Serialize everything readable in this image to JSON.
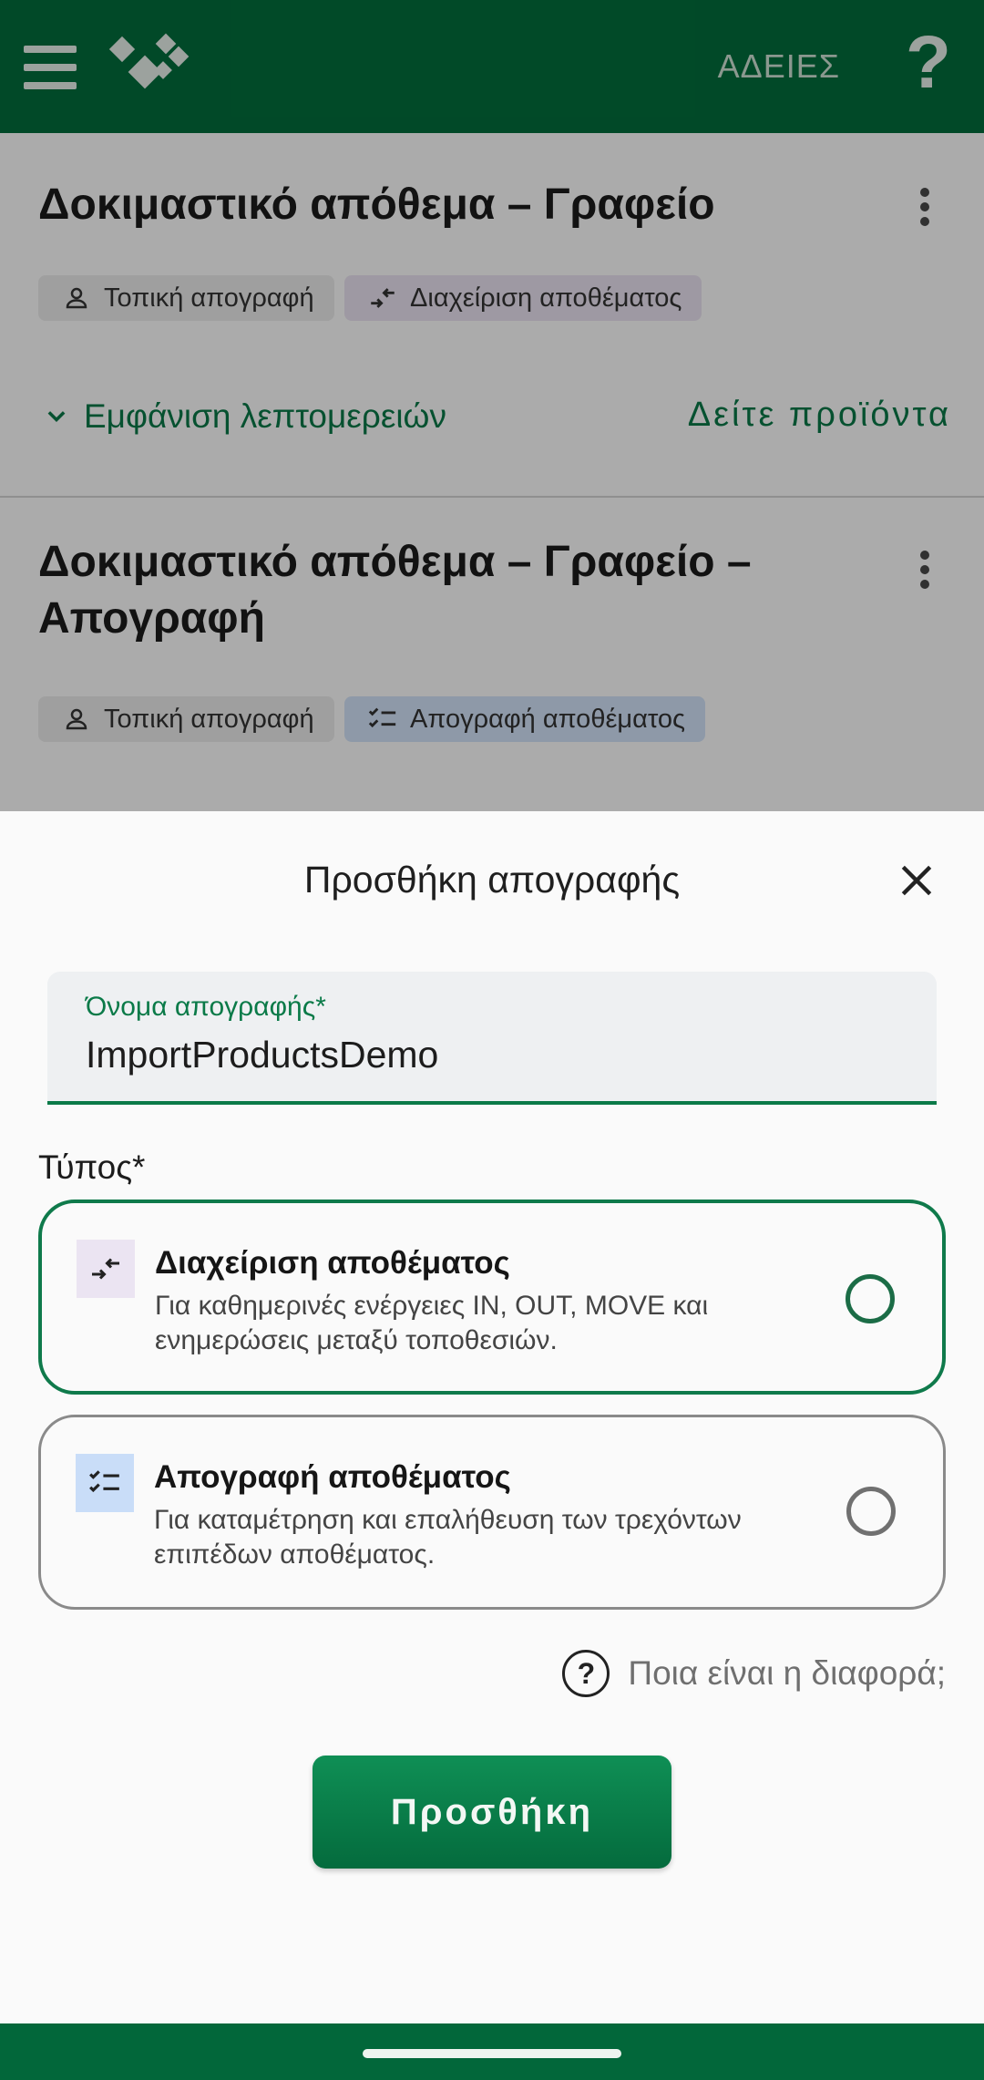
{
  "appbar": {
    "menu_icon": "hamburger-menu-icon",
    "logo_icon": "app-logo-diamonds-icon",
    "licenses_link": "ΑΔΕΙΕΣ",
    "help_icon": "question-mark-icon",
    "help_glyph": "?",
    "colors": {
      "background": "#026e3c"
    }
  },
  "background_list": {
    "cards": [
      {
        "title": "Δοκιμαστικό απόθεμα – Γραφείο",
        "chips": [
          {
            "icon": "person-icon",
            "label": "Τοπική απογραφή"
          },
          {
            "icon": "arrows-in-icon",
            "label": "Διαχείριση αποθέματος"
          }
        ],
        "details_link": "Εμφάνιση λεπτομερειών",
        "see_products": "Δείτε προϊόντα"
      },
      {
        "title": "Δοκιμαστικό απόθεμα – Γραφείο – Απογραφή",
        "chips": [
          {
            "icon": "person-icon",
            "label": "Τοπική απογραφή"
          },
          {
            "icon": "checklist-icon",
            "label": "Απογραφή αποθέματος"
          }
        ]
      }
    ]
  },
  "sheet": {
    "title": "Προσθήκη απογραφής",
    "close_icon": "close-icon",
    "name_field": {
      "label": "Όνομα απογραφής*",
      "value": "ImportProductsDemo"
    },
    "type_label": "Τύπος*",
    "options": [
      {
        "icon": "arrows-in-icon",
        "title": "Διαχείριση αποθέματος",
        "description": "Για καθημερινές ενέργειες IN, OUT, MOVE και ενημερώσεις μεταξύ τοποθεσιών.",
        "selected": false,
        "highlighted": true
      },
      {
        "icon": "checklist-icon",
        "title": "Απογραφή αποθέματος",
        "description": "Για καταμέτρηση και επαλήθευση των τρεχόντων επιπέδων αποθέματος.",
        "selected": false,
        "highlighted": false
      }
    ],
    "difference_link": {
      "icon": "help-circle-icon",
      "glyph": "?",
      "text": "Ποια είναι η διαφορά;"
    },
    "add_button": "Προσθήκη",
    "colors": {
      "accent": "#0a7a48",
      "button": "#0a7f4a"
    }
  }
}
